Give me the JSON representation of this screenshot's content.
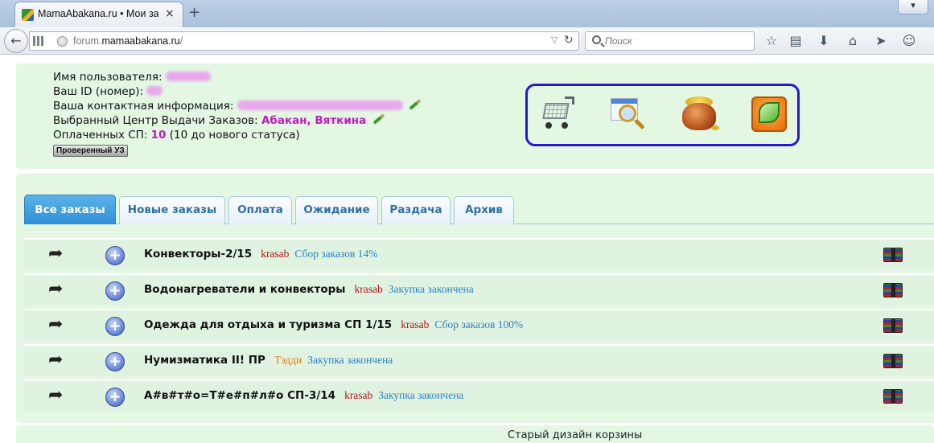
{
  "browser": {
    "tab_title": "MamaAbakana.ru • Мои за",
    "tab_close": "×",
    "new_tab": "+",
    "url_prefix": "forum.",
    "url_domain": "mamaabakana.ru",
    "url_suffix": "/",
    "search_placeholder": "Поиск"
  },
  "user_info": {
    "username_label": "Имя пользователя:",
    "id_label": "Ваш ID (номер):",
    "contact_label": "Ваша контактная информация:",
    "pickup_label": "Выбранный Центр Выдачи Заказов:",
    "pickup_value": "Абакан, Вяткина",
    "paid_label": "Оплаченных СП:",
    "paid_count": "10",
    "paid_note": "(10 до нового статуса)",
    "badge": "Проверенный УЗ"
  },
  "order_tabs": [
    {
      "label": "Все заказы",
      "active": true
    },
    {
      "label": "Новые заказы",
      "active": false
    },
    {
      "label": "Оплата",
      "active": false
    },
    {
      "label": "Ожидание",
      "active": false
    },
    {
      "label": "Раздача",
      "active": false
    },
    {
      "label": "Архив",
      "active": false
    }
  ],
  "orders": [
    {
      "title": "Конвекторы-2/15",
      "author": "krasab",
      "author_color": "#b01414",
      "status": "Сбор заказов 14%"
    },
    {
      "title": "Водонагреватели и конвекторы",
      "author": "krasab",
      "author_color": "#b01414",
      "status": "Закупка закончена"
    },
    {
      "title": "Одежда для отдыха и туризма СП 1/15",
      "author": "krasab",
      "author_color": "#b01414",
      "status": "Сбор заказов 100%"
    },
    {
      "title": "Нумизматика II! ПР",
      "author": "Тэдди",
      "author_color": "#e4781a",
      "status": "Закупка закончена"
    },
    {
      "title": "А#в#т#о=Т#е#п#л#о СП-3/14",
      "author": "krasab",
      "author_color": "#b01414",
      "status": "Закупка закончена"
    }
  ],
  "footer": {
    "old_design_link": "Старый дизайн корзины"
  },
  "colors": {
    "panel_bg": "#e3f7e3",
    "accent_pink": "#c01cc0",
    "status_blue": "#2c82c7",
    "active_tab": "#2f8fd4",
    "icon_box_border": "#2418d6"
  }
}
